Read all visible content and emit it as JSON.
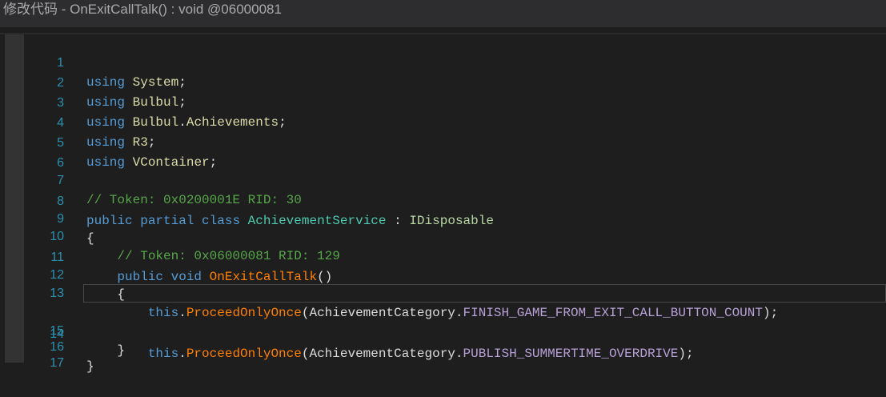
{
  "window": {
    "title": "修改代码 - OnExitCallTalk() : void @06000081"
  },
  "code": {
    "line_numbers": [
      "1",
      "2",
      "3",
      "4",
      "5",
      "6",
      "7",
      "8",
      "9",
      "10",
      "11",
      "12",
      "13",
      "14",
      "15",
      "16",
      "17"
    ],
    "l1": {
      "kw": "using",
      "ns": "System",
      "end": ";"
    },
    "l2": {
      "kw": "using",
      "ns": "Bulbul",
      "end": ";"
    },
    "l3": {
      "kw": "using",
      "ns1": "Bulbul",
      "dot": ".",
      "ns2": "Achievements",
      "end": ";"
    },
    "l4": {
      "kw": "using",
      "ns": "R3",
      "end": ";"
    },
    "l5": {
      "kw": "using",
      "ns": "VContainer",
      "end": ";"
    },
    "l7": {
      "comment": "// Token: 0x0200001E RID: 30"
    },
    "l8": {
      "kw1": "public",
      "kw2": "partial",
      "kw3": "class",
      "cls": "AchievementService",
      "colon": ":",
      "iface": "IDisposable"
    },
    "l9": {
      "brace": "{"
    },
    "l10": {
      "comment": "// Token: 0x06000081 RID: 129"
    },
    "l11": {
      "kw1": "public",
      "kw2": "void",
      "method": "OnExitCallTalk",
      "parens": "()"
    },
    "l12": {
      "brace": "{"
    },
    "l13": {
      "kw": "this",
      "dot": ".",
      "method": "ProceedOnlyOnce",
      "open": "(",
      "type": "AchievementCategory",
      "dot2": ".",
      "member": "FINISH_GAME_FROM_EXIT_CALL_BUTTON_COUNT",
      "close": ");"
    },
    "l14": {
      "kw": "this",
      "dot": ".",
      "method": "ProceedOnlyOnce",
      "open": "(",
      "type": "AchievementCategory",
      "dot2": ".",
      "member": "PUBLISH_SUMMERTIME_OVERDRIVE",
      "close": ");"
    },
    "l15": {
      "brace": "}"
    },
    "l16": {
      "brace": "}"
    }
  }
}
